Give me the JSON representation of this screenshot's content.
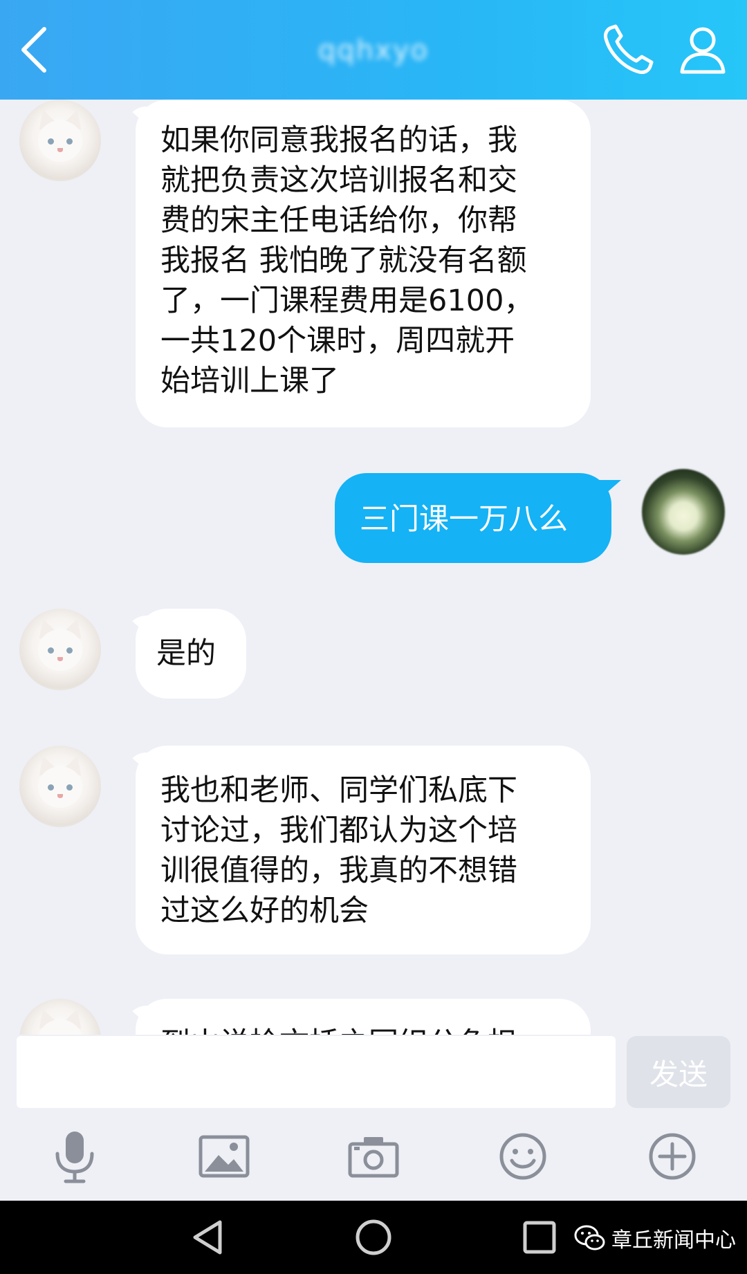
{
  "header": {
    "contact_name": "qqhxyo"
  },
  "messages": [
    {
      "side": "in",
      "text_lines": [
        "如果你同意我报名的话，我",
        "就把负责这次培训报名和交",
        "费的宋主任电话给你，你帮",
        "我报名 我怕晚了就没有名额",
        "了，一门课程费用是6100，",
        "一共120个课时，周四就开",
        "始培训上课了"
      ]
    },
    {
      "side": "out",
      "text": "三门课一万八么"
    },
    {
      "side": "in",
      "text": "是的"
    },
    {
      "side": "in",
      "text_lines": [
        "我也和老师、同学们私底下",
        "讨论过，我们都认为这个培",
        "训很值得的，我真的不想错",
        "过这么好的机会"
      ]
    },
    {
      "side": "in",
      "text": "到山说检文括之园织公负担"
    }
  ],
  "input": {
    "placeholder": "",
    "send_label": "发送"
  },
  "toolbar": {
    "icons": [
      "microphone-icon",
      "image-icon",
      "camera-icon",
      "emoji-icon",
      "plus-icon"
    ]
  },
  "navbar": {
    "watermark": "章丘新闻中心"
  },
  "colors": {
    "header_gradient_start": "#3aa7f3",
    "header_gradient_end": "#26c6f8",
    "outgoing_bubble": "#15b2f5",
    "incoming_bubble": "#ffffff",
    "background": "#eef0f6",
    "icon_gray": "#8a8f99"
  }
}
